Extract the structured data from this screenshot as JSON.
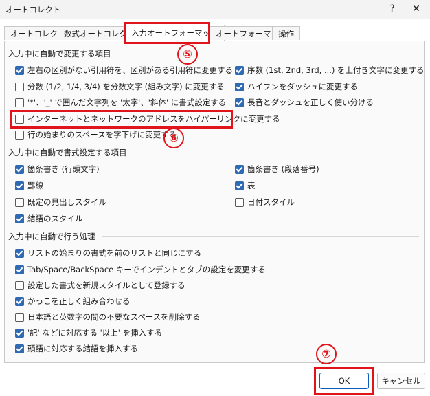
{
  "window": {
    "title": "オートコレクト",
    "help_icon": "?",
    "close_icon": "✕"
  },
  "tabs": [
    "オートコレクト",
    "数式オートコレクト",
    "入力オートフォーマット",
    "オートフォーマット",
    "操作"
  ],
  "active_tab": "入力オートフォーマット",
  "sections": [
    {
      "title": "入力中に自動で変更する項目",
      "left": [
        {
          "label": "左右の区別がない引用符を、区別がある引用符に変更する",
          "checked": true
        },
        {
          "label": "分数 (1/2, 1/4, 3/4) を分数文字 (組み文字) に変更する",
          "checked": false
        },
        {
          "label": "'*'、'_' で囲んだ文字列を '太字'、'斜体' に書式設定する",
          "checked": false
        },
        {
          "label": "インターネットとネットワークのアドレスをハイパーリンクに変更する",
          "checked": false
        },
        {
          "label": "行の始まりのスペースを字下げに変更する",
          "checked": false
        }
      ],
      "right": [
        {
          "label": "序数 (1st, 2nd, 3rd, ...) を上付き文字に変更する",
          "checked": true
        },
        {
          "label": "ハイフンをダッシュに変更する",
          "checked": true
        },
        {
          "label": "長音とダッシュを正しく使い分ける",
          "checked": true
        }
      ]
    },
    {
      "title": "入力中に自動で書式設定する項目",
      "left": [
        {
          "label": "箇条書き (行頭文字)",
          "checked": true
        },
        {
          "label": "罫線",
          "checked": true
        },
        {
          "label": "既定の見出しスタイル",
          "checked": false
        },
        {
          "label": "結語のスタイル",
          "checked": true
        }
      ],
      "right": [
        {
          "label": "箇条書き (段落番号)",
          "checked": true
        },
        {
          "label": "表",
          "checked": true
        },
        {
          "label": "日付スタイル",
          "checked": false
        }
      ]
    },
    {
      "title": "入力中に自動で行う処理",
      "left": [
        {
          "label": "リストの始まりの書式を前のリストと同じにする",
          "checked": true
        },
        {
          "label": "Tab/Space/BackSpace キーでインデントとタブの設定を変更する",
          "checked": true
        },
        {
          "label": "設定した書式を新規スタイルとして登録する",
          "checked": false
        },
        {
          "label": "かっこを正しく組み合わせる",
          "checked": true
        },
        {
          "label": "日本語と英数字の間の不要なスペースを削除する",
          "checked": false
        },
        {
          "label": "'記' などに対応する '以上' を挿入する",
          "checked": true
        },
        {
          "label": "頭語に対応する結語を挿入する",
          "checked": true
        }
      ],
      "right": []
    }
  ],
  "markers": [
    "⑤",
    "⑥",
    "⑦"
  ],
  "buttons": {
    "ok": "OK",
    "cancel": "キャンセル"
  },
  "colors": {
    "accent": "#2f6ab3",
    "highlight": "#e0151b"
  }
}
